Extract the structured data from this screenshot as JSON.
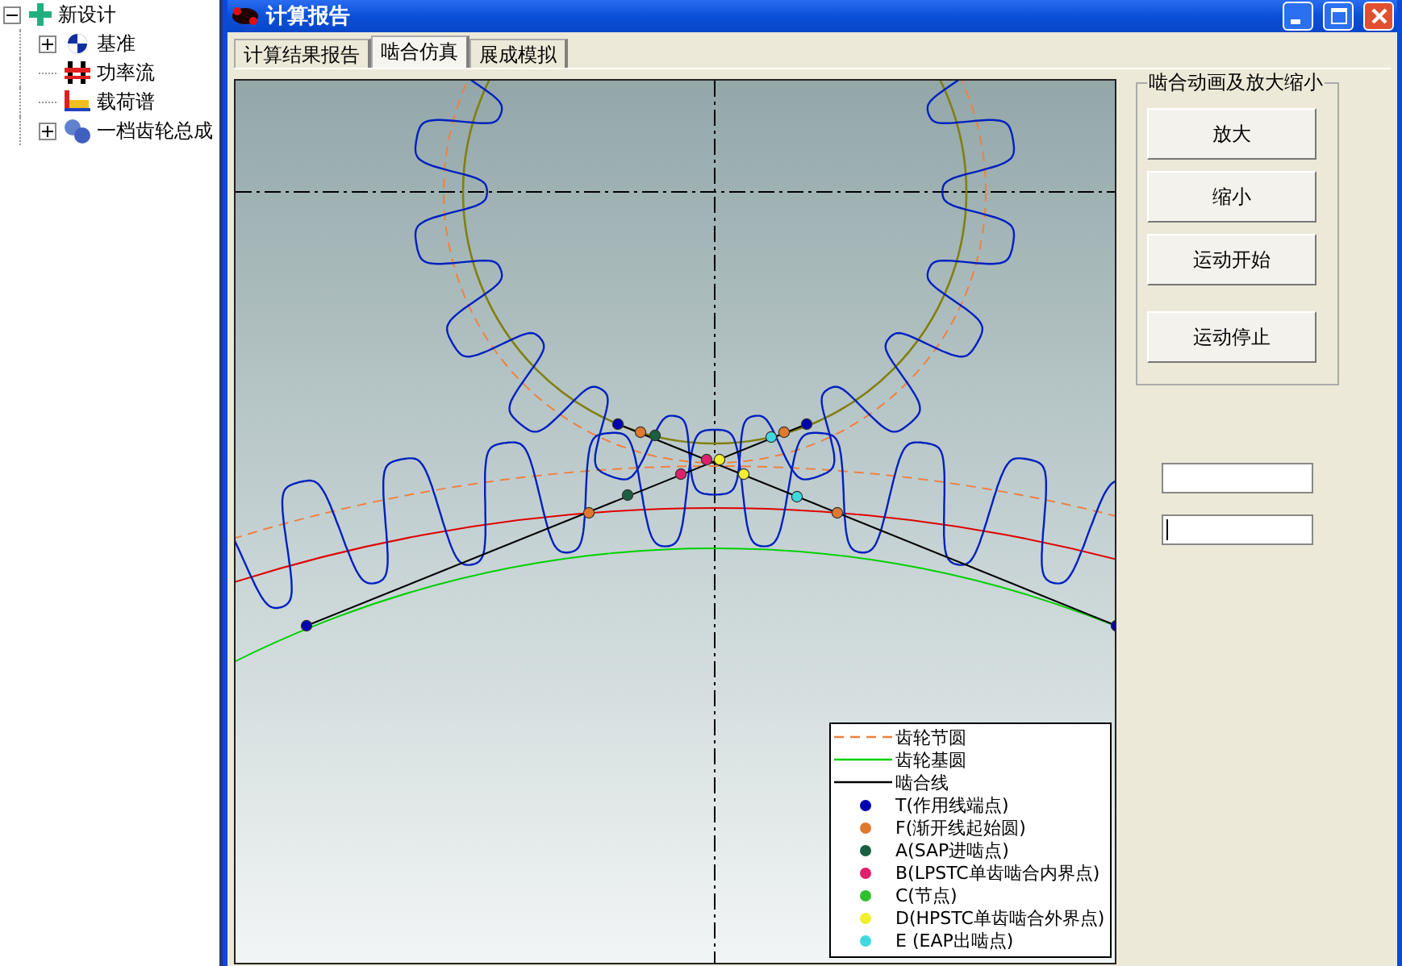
{
  "tree": {
    "items": [
      {
        "label": "新设计",
        "expanded": true,
        "has_children": true,
        "children": [
          {
            "label": "基准",
            "expanded": false,
            "has_children": true
          },
          {
            "label": "功率流",
            "has_children": false
          },
          {
            "label": "载荷谱",
            "has_children": false
          },
          {
            "label": "一档齿轮总成",
            "expanded": false,
            "has_children": true
          }
        ]
      }
    ]
  },
  "window": {
    "title": "计算报告"
  },
  "tabs": [
    {
      "label": "计算结果报告",
      "selected": false
    },
    {
      "label": "啮合仿真",
      "selected": true
    },
    {
      "label": "展成模拟",
      "selected": false
    }
  ],
  "legend": [
    {
      "kind": "dashed",
      "color": "#f08040",
      "label": "齿轮节圆"
    },
    {
      "kind": "line",
      "color": "#00d000",
      "label": "齿轮基圆"
    },
    {
      "kind": "line",
      "color": "#000000",
      "label": "啮合线"
    },
    {
      "kind": "dot",
      "color": "#0000b0",
      "label": "T(作用线端点)"
    },
    {
      "kind": "dot",
      "color": "#e07830",
      "label": "F(渐开线起始圆)"
    },
    {
      "kind": "dot",
      "color": "#1a6040",
      "label": "A(SAP进啮点)"
    },
    {
      "kind": "dot",
      "color": "#e0206a",
      "label": "B(LPSTC单齿啮合内界点)"
    },
    {
      "kind": "dot",
      "color": "#30c030",
      "label": "C(节点)"
    },
    {
      "kind": "dot",
      "color": "#f0f030",
      "label": "D(HPSTC单齿啮合外界点)"
    },
    {
      "kind": "dot",
      "color": "#40d8e0",
      "label": "E (EAP出啮点)"
    }
  ],
  "group": {
    "title": "啮合动画及放大缩小",
    "buttons": [
      "放大",
      "缩小",
      "运动开始",
      "运动停止"
    ]
  },
  "inputs": [
    {
      "focused": false
    },
    {
      "focused": true
    }
  ]
}
